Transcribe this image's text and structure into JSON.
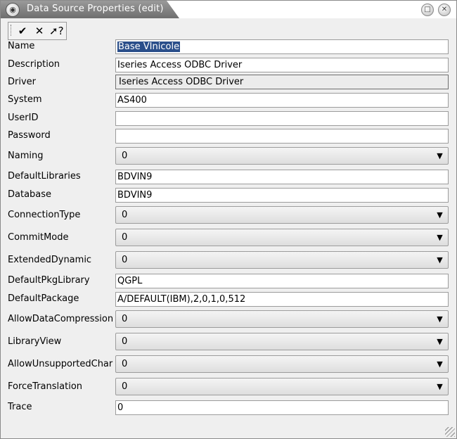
{
  "window": {
    "title": "Data Source Properties (edit)"
  },
  "toolbar": {
    "ok_icon": "checkmark-icon",
    "cancel_icon": "x-icon",
    "help_icon": "whats-this-help-icon"
  },
  "fields": {
    "name": {
      "label": "Name",
      "value": "Base VInicole"
    },
    "description": {
      "label": "Description",
      "value": "Iseries Access ODBC Driver"
    },
    "driver": {
      "label": "Driver",
      "value": "Iseries Access ODBC Driver"
    },
    "system": {
      "label": "System",
      "value": "AS400"
    },
    "userid": {
      "label": "UserID",
      "value": ""
    },
    "password": {
      "label": "Password",
      "value": ""
    },
    "naming": {
      "label": "Naming",
      "value": "0"
    },
    "default_libraries": {
      "label": "DefaultLibraries",
      "value": "BDVIN9"
    },
    "database": {
      "label": "Database",
      "value": "BDVIN9"
    },
    "connection_type": {
      "label": "ConnectionType",
      "value": "0"
    },
    "commit_mode": {
      "label": "CommitMode",
      "value": "0"
    },
    "extended_dynamic": {
      "label": "ExtendedDynamic",
      "value": "0"
    },
    "default_pkg_library": {
      "label": "DefaultPkgLibrary",
      "value": "QGPL"
    },
    "default_package": {
      "label": "DefaultPackage",
      "value": "A/DEFAULT(IBM),2,0,1,0,512"
    },
    "allow_data_compression": {
      "label": "AllowDataCompression",
      "value": "0"
    },
    "library_view": {
      "label": "LibraryView",
      "value": "0"
    },
    "allow_unsupported_char": {
      "label": "AllowUnsupportedChar",
      "value": "0"
    },
    "force_translation": {
      "label": "ForceTranslation",
      "value": "0"
    },
    "trace": {
      "label": "Trace",
      "value": "0"
    }
  }
}
